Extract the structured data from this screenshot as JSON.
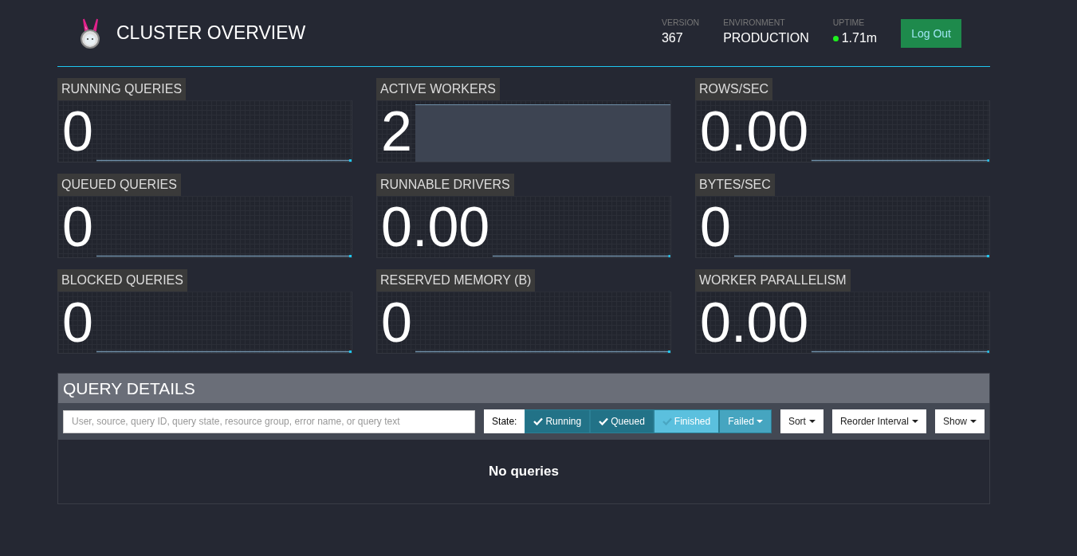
{
  "header": {
    "title": "CLUSTER OVERVIEW",
    "stats": [
      {
        "label": "VERSION",
        "value": "367",
        "kind": "plain"
      },
      {
        "label": "ENVIRONMENT",
        "value": "PRODUCTION",
        "kind": "plain"
      },
      {
        "label": "UPTIME",
        "value": "1.71m",
        "kind": "status"
      }
    ],
    "logout": "Log Out"
  },
  "metrics": [
    {
      "label": "RUNNING QUERIES",
      "value": "0",
      "kind": "flat"
    },
    {
      "label": "ACTIVE WORKERS",
      "value": "2",
      "kind": "filled"
    },
    {
      "label": "ROWS/SEC",
      "value": "0.00",
      "kind": "flat"
    },
    {
      "label": "QUEUED QUERIES",
      "value": "0",
      "kind": "flat"
    },
    {
      "label": "RUNNABLE DRIVERS",
      "value": "0.00",
      "kind": "flat"
    },
    {
      "label": "BYTES/SEC",
      "value": "0",
      "kind": "flat"
    },
    {
      "label": "BLOCKED QUERIES",
      "value": "0",
      "kind": "flat"
    },
    {
      "label": "RESERVED MEMORY (B)",
      "value": "0",
      "kind": "flat"
    },
    {
      "label": "WORKER PARALLELISM",
      "value": "0.00",
      "kind": "flat"
    }
  ],
  "query_details": {
    "title": "QUERY DETAILS",
    "search": {
      "placeholder": "User, source, query ID, query state, resource group, error name, or query text"
    },
    "state_label": "State:",
    "states": [
      {
        "label": "Running",
        "kind": "toggle",
        "checked": true
      },
      {
        "label": "Queued",
        "kind": "toggle",
        "checked": true
      },
      {
        "label": "Finished",
        "kind": "toggle",
        "checked": false
      },
      {
        "label": "Failed",
        "kind": "dropdown"
      }
    ],
    "menus": [
      "Sort",
      "Reorder Interval",
      "Show"
    ],
    "empty": "No queries"
  }
}
